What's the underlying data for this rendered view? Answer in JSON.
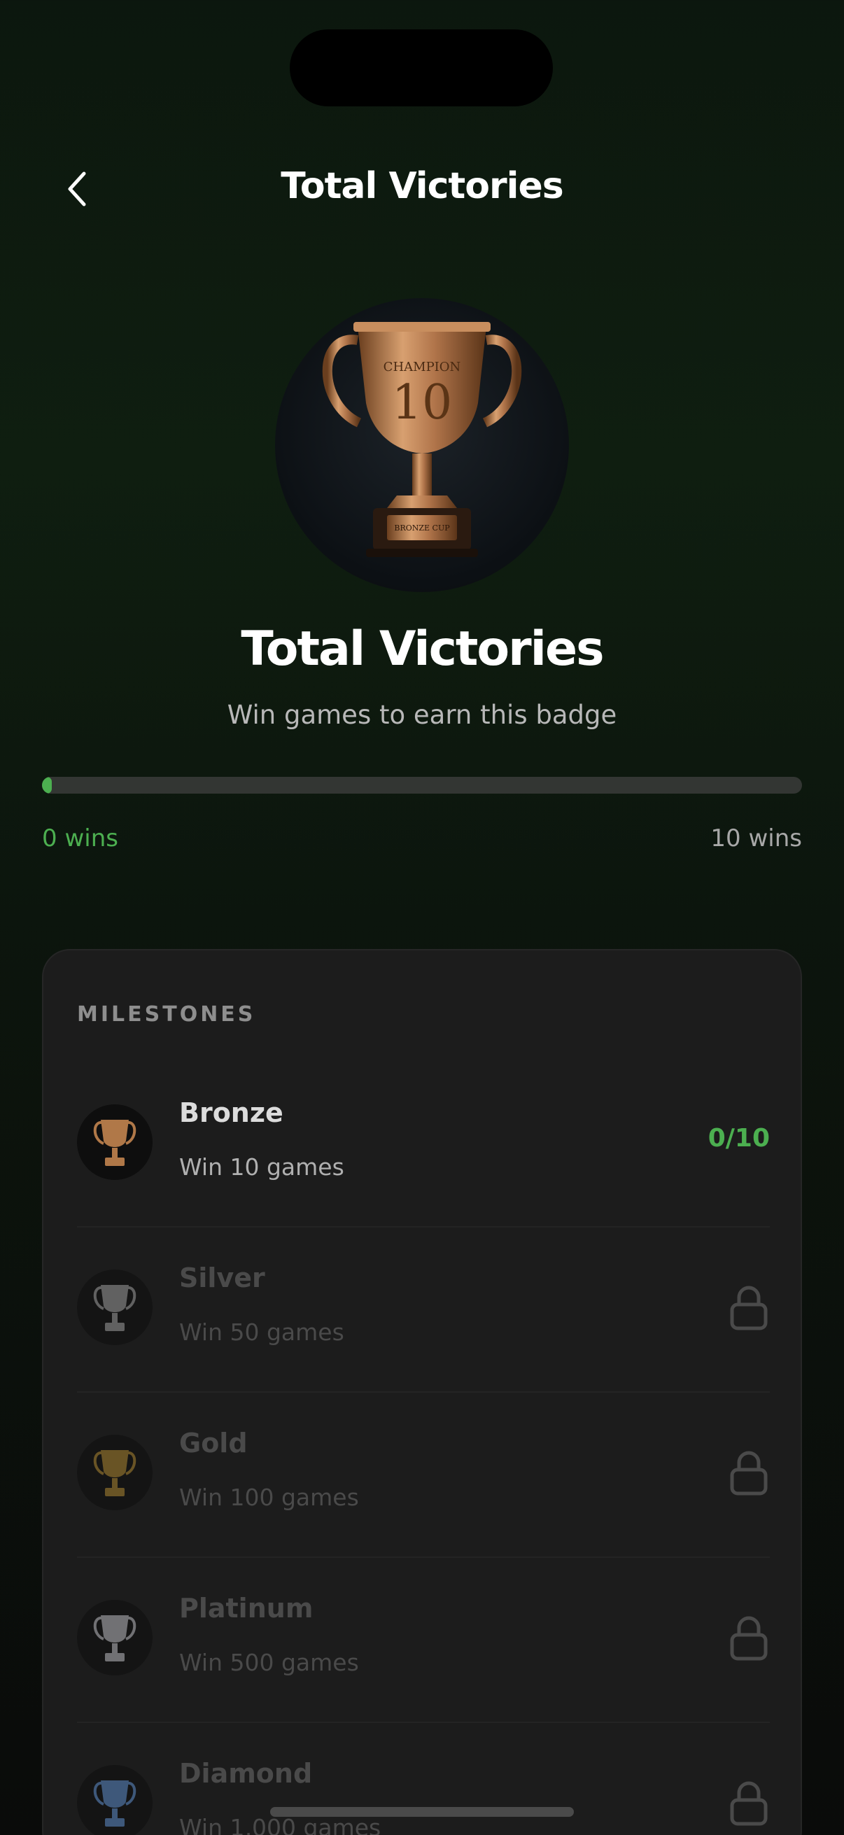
{
  "header": {
    "title": "Total Victories"
  },
  "hero": {
    "trophy_engraving": "CHAMPION",
    "trophy_number": "10",
    "plaque_text": "BRONZE CUP",
    "title": "Total Victories",
    "subtitle": "Win games to earn this badge"
  },
  "progress": {
    "current_label": "0 wins",
    "target_label": "10 wins",
    "fraction": 0,
    "accent_color": "#4caf50"
  },
  "milestones": {
    "heading": "MILESTONES",
    "items": [
      {
        "name": "Bronze",
        "desc": "Win 10 games",
        "count": "0/10",
        "locked": false,
        "metal": "#b07848"
      },
      {
        "name": "Silver",
        "desc": "Win 50 games",
        "locked": true,
        "metal": "#9a9a9a"
      },
      {
        "name": "Gold",
        "desc": "Win 100 games",
        "locked": true,
        "metal": "#a8822e"
      },
      {
        "name": "Platinum",
        "desc": "Win 500 games",
        "locked": true,
        "metal": "#b8b8bc"
      },
      {
        "name": "Diamond",
        "desc": "Win 1,000 games",
        "locked": true,
        "metal": "#5a8ac8"
      }
    ]
  },
  "icons": {
    "back": "chevron-left-icon",
    "lock": "lock-icon",
    "trophy": "trophy-icon"
  }
}
